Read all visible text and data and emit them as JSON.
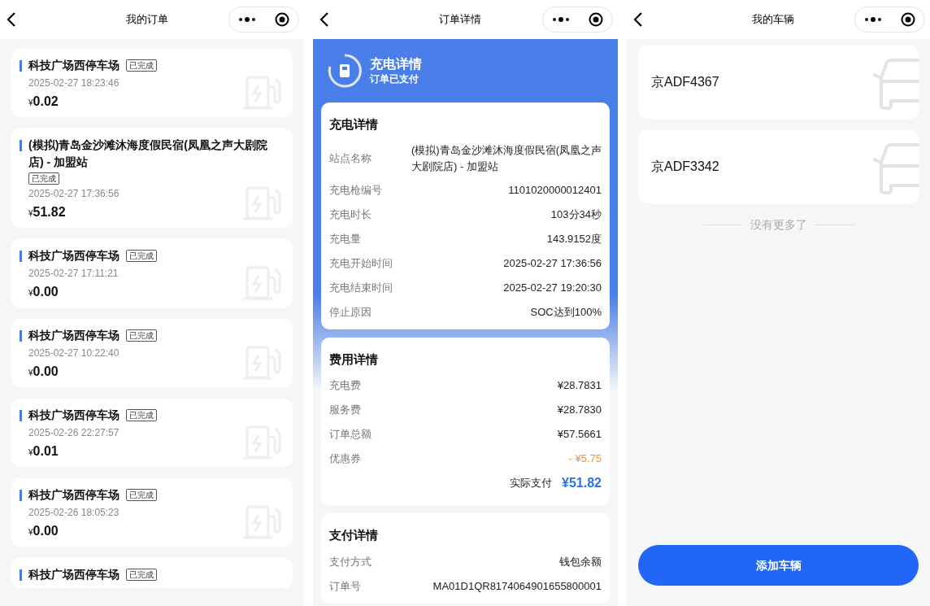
{
  "orders_screen": {
    "title": "我的订单",
    "orders": [
      {
        "station": "科技广场西停车场",
        "status": "已完成",
        "time": "2025-02-27 18:23:46",
        "currency": "¥",
        "amount": "0.02"
      },
      {
        "station": "(模拟)青岛金沙滩沐海度假民宿(凤凰之声大剧院店) - 加盟站",
        "status": "已完成",
        "time": "2025-02-27 17:36:56",
        "currency": "¥",
        "amount": "51.82"
      },
      {
        "station": "科技广场西停车场",
        "status": "已完成",
        "time": "2025-02-27 17:11:21",
        "currency": "¥",
        "amount": "0.00"
      },
      {
        "station": "科技广场西停车场",
        "status": "已完成",
        "time": "2025-02-27 10:22:40",
        "currency": "¥",
        "amount": "0.00"
      },
      {
        "station": "科技广场西停车场",
        "status": "已完成",
        "time": "2025-02-26 22:27:57",
        "currency": "¥",
        "amount": "0.01"
      },
      {
        "station": "科技广场西停车场",
        "status": "已完成",
        "time": "2025-02-26 18:05:23",
        "currency": "¥",
        "amount": "0.00"
      },
      {
        "station": "科技广场西停车场",
        "status": "已完成"
      }
    ]
  },
  "detail_screen": {
    "title": "订单详情",
    "banner": {
      "title": "充电详情",
      "subtitle": "订单已支付"
    },
    "sections": [
      {
        "title": "充电详情",
        "rows": [
          {
            "label": "站点名称",
            "value": "(模拟)青岛金沙滩沐海度假民宿(凤凰之声大剧院店) - 加盟站"
          },
          {
            "label": "充电枪编号",
            "value": "1101020000012401"
          },
          {
            "label": "充电时长",
            "value": "103分34秒"
          },
          {
            "label": "充电量",
            "value": "143.9152度"
          },
          {
            "label": "充电开始时间",
            "value": "2025-02-27 17:36:56"
          },
          {
            "label": "充电结束时间",
            "value": "2025-02-27 19:20:30"
          },
          {
            "label": "停止原因",
            "value": "SOC达到100%"
          }
        ]
      },
      {
        "title": "费用详情",
        "rows": [
          {
            "label": "充电费",
            "value": "¥28.7831",
            "kind": "normal"
          },
          {
            "label": "服务费",
            "value": "¥28.7830",
            "kind": "normal"
          },
          {
            "label": "订单总额",
            "value": "¥57.5661",
            "kind": "normal"
          },
          {
            "label": "优惠券",
            "value": "- ¥5.75",
            "kind": "discount"
          }
        ],
        "total": {
          "label": "实际支付",
          "value": "¥51.82"
        }
      },
      {
        "title": "支付详情",
        "rows": [
          {
            "label": "支付方式",
            "value": "钱包余额"
          },
          {
            "label": "订单号",
            "value": "MA01D1QR8174064901655800001"
          }
        ]
      }
    ]
  },
  "vehicles_screen": {
    "title": "我的车辆",
    "vehicles": [
      {
        "plate": "京ADF4367"
      },
      {
        "plate": "京ADF3342"
      }
    ],
    "end_note": "没有更多了",
    "add_button": "添加车辆"
  }
}
